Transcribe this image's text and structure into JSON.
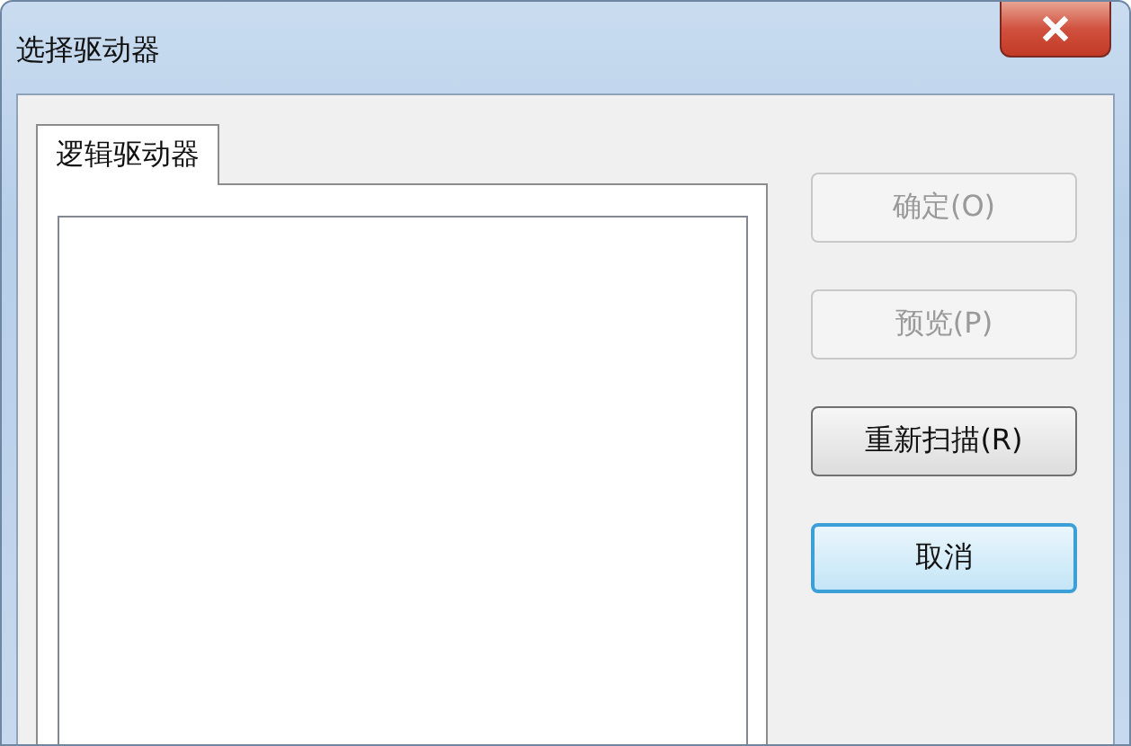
{
  "window": {
    "title": "选择驱动器"
  },
  "tabs": [
    {
      "label": "逻辑驱动器",
      "selected": true
    }
  ],
  "buttons": [
    {
      "label": "确定(O)",
      "disabled": true,
      "default": false
    },
    {
      "label": "预览(P)",
      "disabled": true,
      "default": false
    },
    {
      "label": "重新扫描(R)",
      "disabled": false,
      "default": false
    },
    {
      "label": "取消",
      "disabled": false,
      "default": true
    }
  ]
}
